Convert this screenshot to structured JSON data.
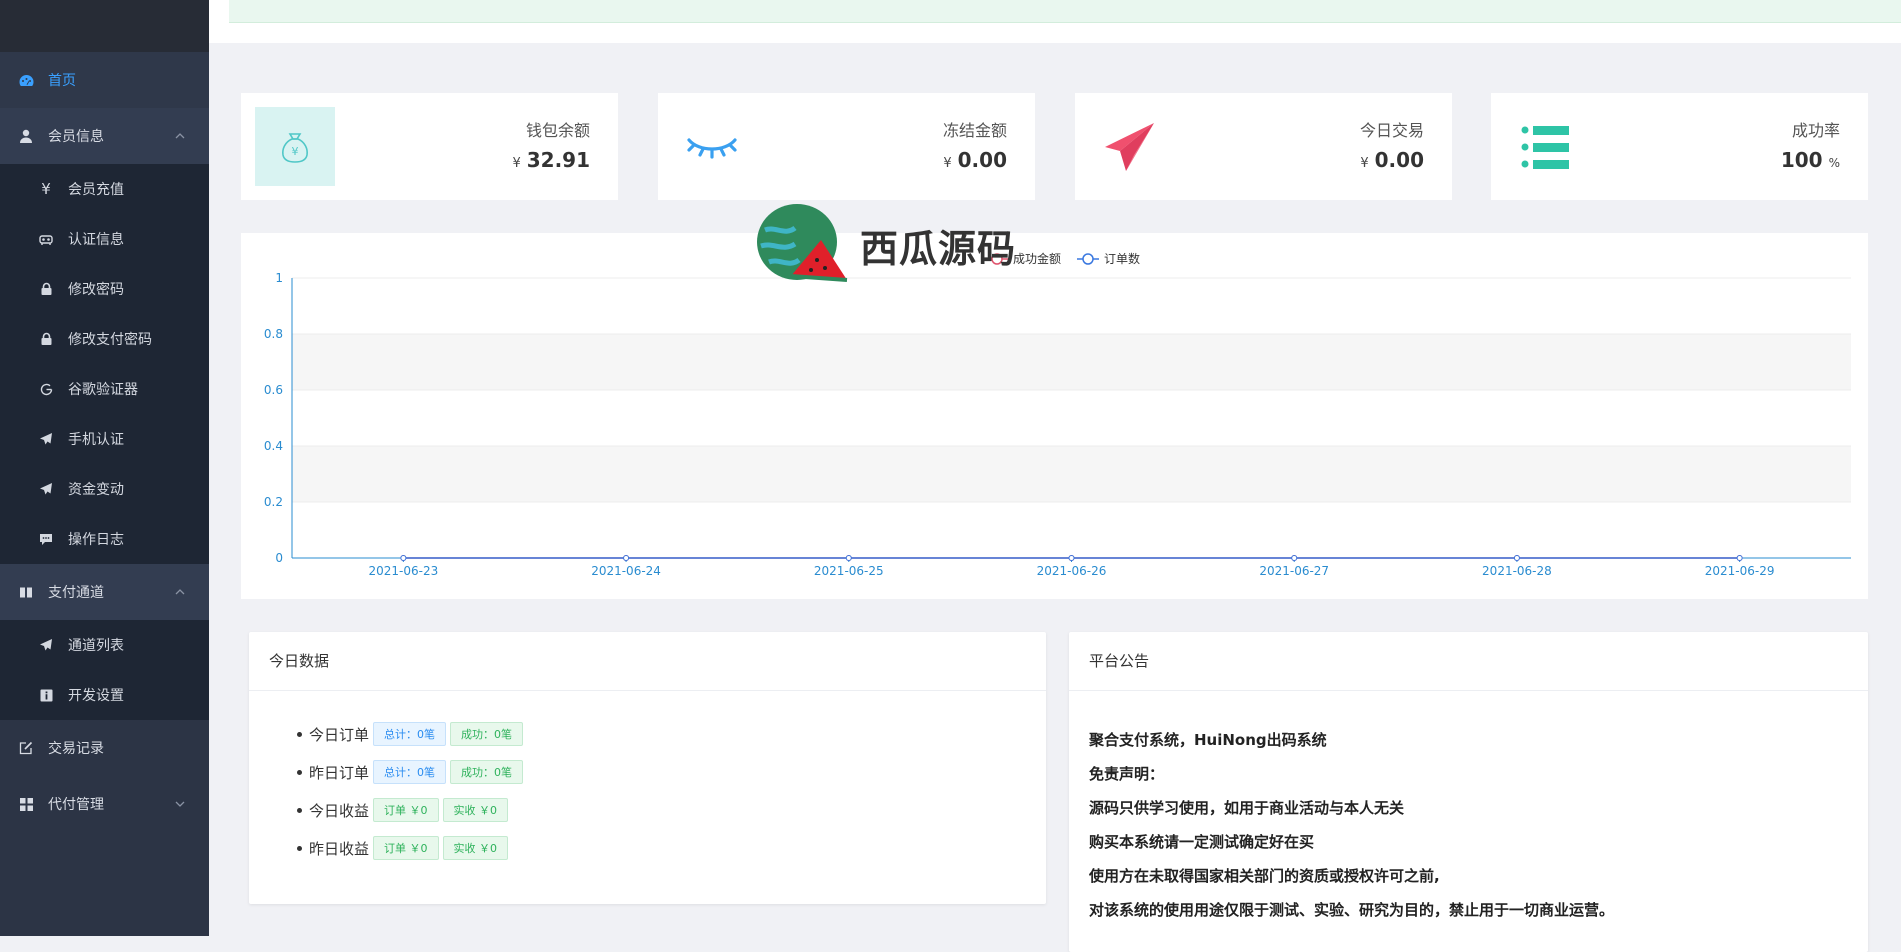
{
  "sidebar": {
    "items": [
      {
        "label": "首页",
        "icon": "dashboard-icon",
        "active": true
      },
      {
        "label": "会员信息",
        "icon": "user-icon",
        "expanded": true,
        "children": [
          {
            "label": "会员充值",
            "icon": "yen-icon"
          },
          {
            "label": "认证信息",
            "icon": "id-card-icon"
          },
          {
            "label": "修改密码",
            "icon": "lock-icon"
          },
          {
            "label": "修改支付密码",
            "icon": "lock-icon"
          },
          {
            "label": "谷歌验证器",
            "icon": "google-icon"
          },
          {
            "label": "手机认证",
            "icon": "paper-plane-icon"
          },
          {
            "label": "资金变动",
            "icon": "paper-plane-icon"
          },
          {
            "label": "操作日志",
            "icon": "comment-icon"
          }
        ]
      },
      {
        "label": "支付通道",
        "icon": "book-icon",
        "expanded": true,
        "children": [
          {
            "label": "通道列表",
            "icon": "paper-plane-icon"
          },
          {
            "label": "开发设置",
            "icon": "info-icon"
          }
        ]
      },
      {
        "label": "交易记录",
        "icon": "edit-icon"
      },
      {
        "label": "代付管理",
        "icon": "grid-icon",
        "expanded": false
      }
    ]
  },
  "stats": [
    {
      "label": "钱包余额",
      "currency": "¥",
      "value": "32.91",
      "icon": "money-bag-icon",
      "color": "#4fc7c7"
    },
    {
      "label": "冻结金额",
      "currency": "¥",
      "value": "0.00",
      "icon": "closed-eye-icon",
      "color": "#3aa0f0"
    },
    {
      "label": "今日交易",
      "currency": "¥",
      "value": "0.00",
      "icon": "paper-plane-icon",
      "color": "#f0506e"
    },
    {
      "label": "成功率",
      "value": "100",
      "unit": "%",
      "icon": "list-icon",
      "color": "#2ec4a6"
    }
  ],
  "chart_data": {
    "type": "line",
    "x": [
      "2021-06-23",
      "2021-06-24",
      "2021-06-25",
      "2021-06-26",
      "2021-06-27",
      "2021-06-28",
      "2021-06-29"
    ],
    "series": [
      {
        "name": "成功金额",
        "values": [
          0,
          0,
          0,
          0,
          0,
          0,
          0
        ],
        "color": "#e0556e"
      },
      {
        "name": "订单数",
        "values": [
          0,
          0,
          0,
          0,
          0,
          0,
          0
        ],
        "color": "#3a78e0"
      }
    ],
    "yticks": [
      "0",
      "0.2",
      "0.4",
      "0.6",
      "0.8",
      "1"
    ],
    "ylim": [
      0,
      1
    ],
    "legend": "top-center",
    "grid": true
  },
  "today": {
    "title": "今日数据",
    "rows": [
      {
        "label": "今日订单",
        "tags": [
          {
            "text": "总计：0笔",
            "style": "blue"
          },
          {
            "text": "成功：0笔",
            "style": "green"
          }
        ]
      },
      {
        "label": "昨日订单",
        "tags": [
          {
            "text": "总计：0笔",
            "style": "blue"
          },
          {
            "text": "成功：0笔",
            "style": "green"
          }
        ]
      },
      {
        "label": "今日收益",
        "tags": [
          {
            "text": "订单 ￥0",
            "style": "green"
          },
          {
            "text": "实收 ￥0",
            "style": "green"
          }
        ]
      },
      {
        "label": "昨日收益",
        "tags": [
          {
            "text": "订单 ￥0",
            "style": "green"
          },
          {
            "text": "实收 ￥0",
            "style": "green"
          }
        ]
      }
    ]
  },
  "notice": {
    "title": "平台公告",
    "lines": [
      "聚合支付系统，HuiNong出码系统",
      "免责声明：",
      "源码只供学习使用，如用于商业活动与本人无关",
      "购买本系统请一定测试确定好在买",
      "使用方在未取得国家相关部门的资质或授权许可之前,",
      "对该系统的使用用途仅限于测试、实验、研究为目的，禁止用于一切商业运营。"
    ]
  },
  "watermark": {
    "text": "西瓜源码"
  }
}
